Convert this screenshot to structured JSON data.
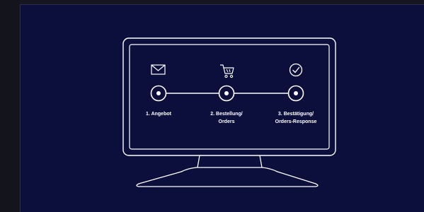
{
  "colors": {
    "background": "#0c0e3c",
    "outer": "#1a1a26",
    "stroke": "#ffffff"
  },
  "steps": [
    {
      "icon": "mail-icon",
      "line1": "1. Angebot",
      "line2": ""
    },
    {
      "icon": "cart-icon",
      "line1": "2. Bestellung/",
      "line2": "Orders"
    },
    {
      "icon": "check-circle-icon",
      "line1": "3. Bestätigung/",
      "line2": "Orders-Response"
    }
  ]
}
